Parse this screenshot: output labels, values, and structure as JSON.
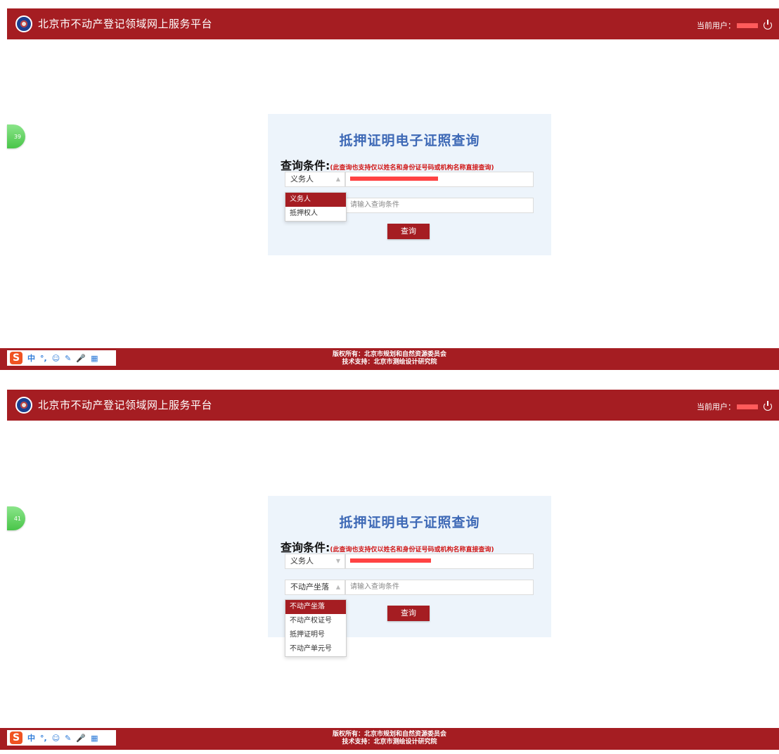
{
  "app_title": "北京市不动产登记领域网上服务平台",
  "current_user_label": "当前用户：",
  "query": {
    "title": "抵押证明电子证照查询",
    "condition_label": "查询条件:",
    "condition_note": "(此查询也支持仅以姓名和身份证号码或机构名称直接查询)",
    "input_placeholder": "请输入查询条件",
    "button_label": "查询"
  },
  "panel1": {
    "badge": "39",
    "row1_select": "义务人",
    "dropdown": [
      "义务人",
      "抵押权人"
    ]
  },
  "panel2": {
    "badge": "41",
    "row1_select": "义务人",
    "row2_select": "不动产坐落",
    "dropdown": [
      "不动产坐落",
      "不动产权证号",
      "抵押证明号",
      "不动产单元号"
    ]
  },
  "footer": {
    "line1": "版权所有：北京市规划和自然资源委员会",
    "line2": "技术支持：北京市测绘设计研究院"
  },
  "ime": {
    "logo": "S",
    "items": [
      "中",
      "°,",
      "☺",
      "✎",
      "🎤",
      "▦"
    ]
  },
  "colors": {
    "brand_red": "#a51d22",
    "title_blue": "#3e69b6",
    "card_bg": "#edf4fb"
  }
}
